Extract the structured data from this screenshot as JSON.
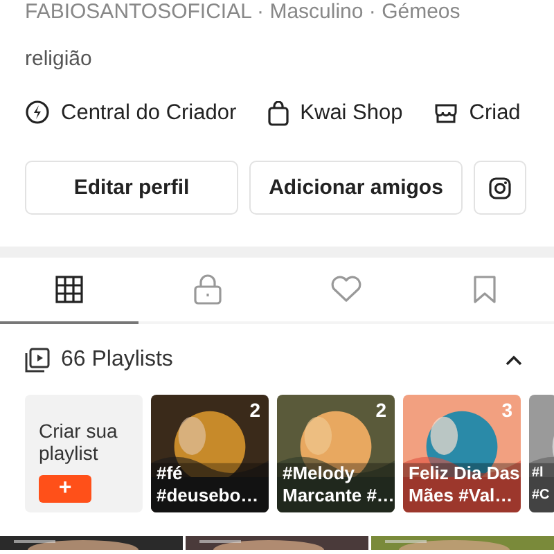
{
  "profile_line": "FABIOSANTOSOFICIAL · Masculino · Gémeos",
  "bio": "religião",
  "links": [
    {
      "kind": "bolt",
      "label": "Central do Criador"
    },
    {
      "kind": "bag",
      "label": "Kwai Shop"
    },
    {
      "kind": "store",
      "label": "Criad"
    }
  ],
  "buttons": [
    {
      "kind": "text",
      "label": "Editar perfil"
    },
    {
      "kind": "text",
      "label": "Adicionar amigos"
    },
    {
      "kind": "instagram"
    }
  ],
  "tabs": [
    {
      "kind": "grid",
      "selected": true
    },
    {
      "kind": "lock",
      "selected": false
    },
    {
      "kind": "heart",
      "selected": false
    },
    {
      "kind": "bookmark",
      "selected": false
    }
  ],
  "playlists": {
    "title": "66 Playlists",
    "expanded": true,
    "create": {
      "label": "Criar sua playlist",
      "button": "+"
    },
    "items": [
      {
        "count": "2",
        "title_lines": [
          "#fé",
          "#deusebo…"
        ],
        "kind": "picture"
      },
      {
        "count": "2",
        "title_lines": [
          "#Melody",
          "Marcante #…"
        ],
        "kind": "picture"
      },
      {
        "count": "3",
        "title_lines": [
          "Feliz Dia Das",
          "Mães #Val…"
        ],
        "kind": "picture"
      },
      {
        "title_lines": [
          "#l",
          "#C"
        ],
        "kind": "picture"
      }
    ]
  }
}
